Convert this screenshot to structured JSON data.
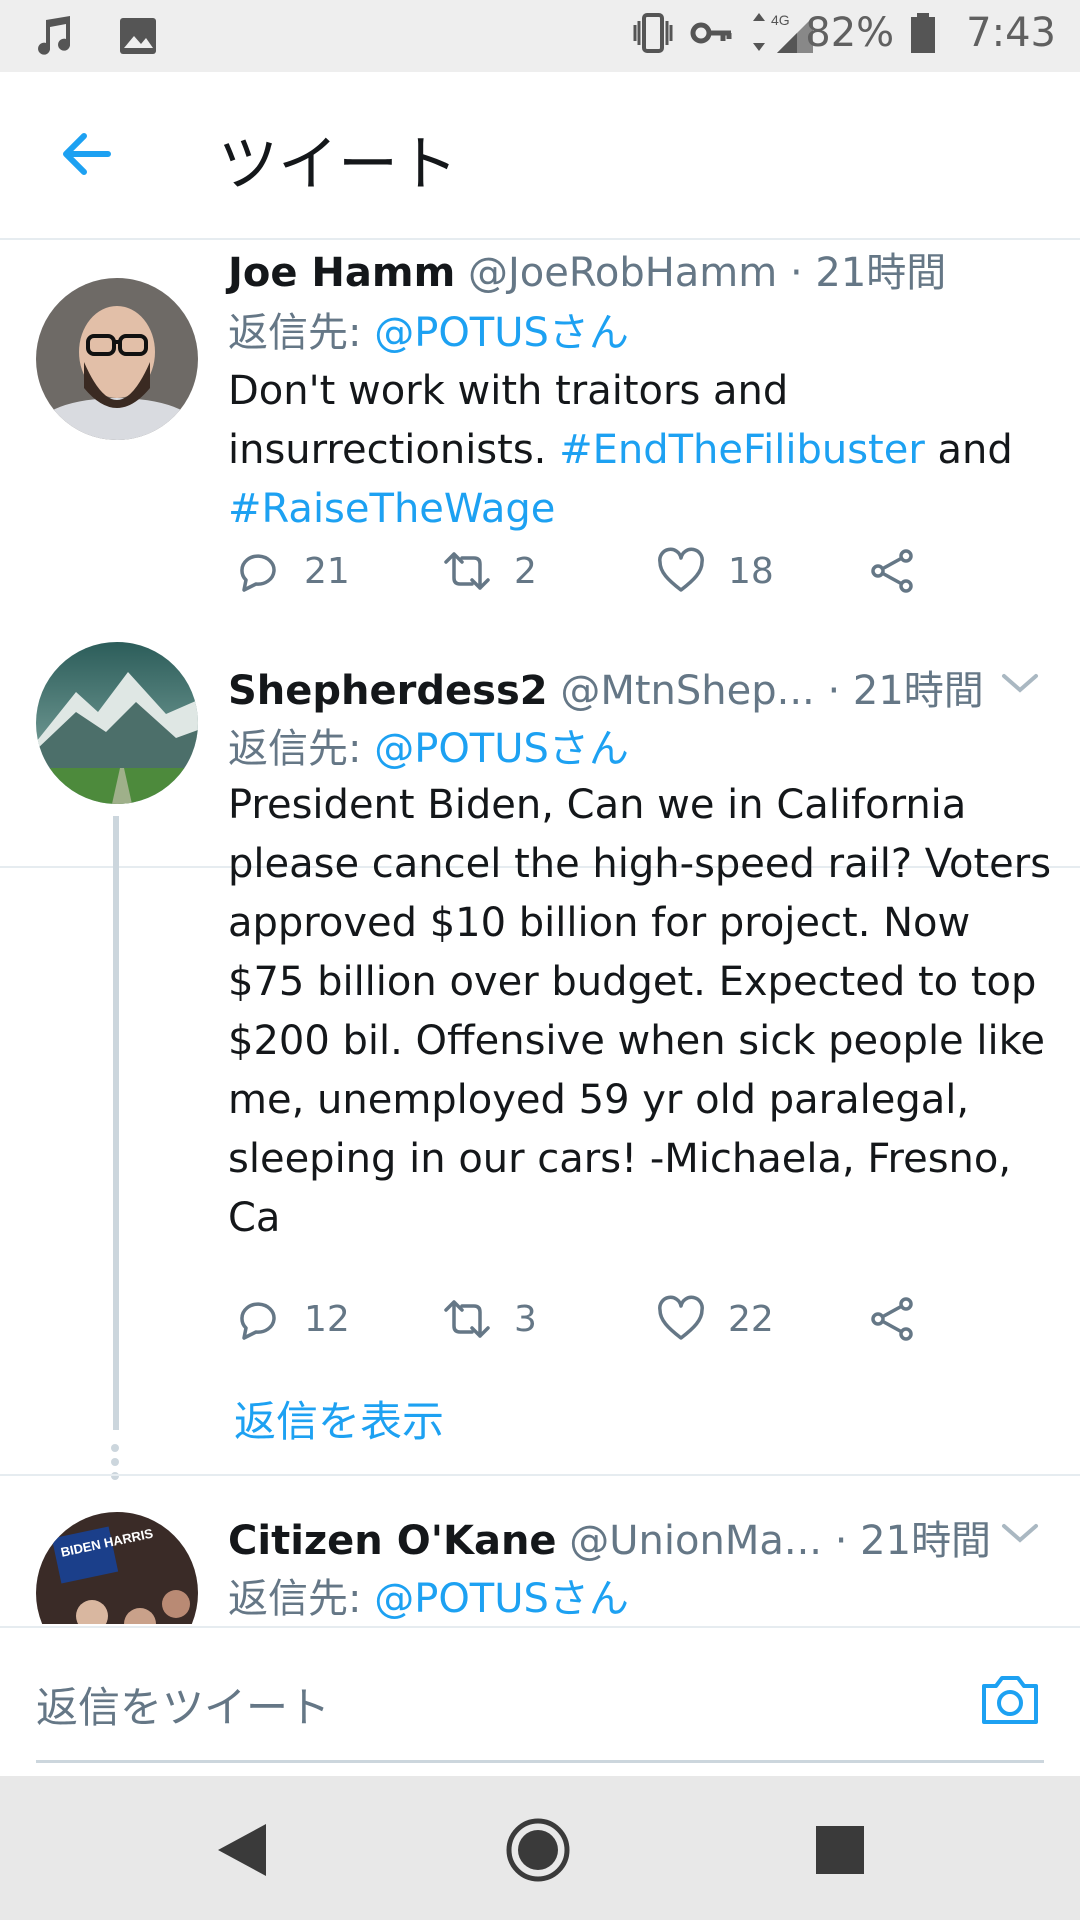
{
  "status_bar": {
    "battery": "82%",
    "network": "4G",
    "time": "7:43"
  },
  "header": {
    "title": "ツイート"
  },
  "tweets": [
    {
      "name": "Joe Hamm",
      "handle": "@JoeRobHamm",
      "time": "· 21時間",
      "reply_prefix": "返信先: ",
      "reply_to": "@POTUSさん",
      "text_1": "Don't work with traitors and insurrectionists. ",
      "hashtag_1": "#EndTheFilibuster",
      "text_2": " and ",
      "hashtag_2": "#RaiseTheWage",
      "replies": "21",
      "retweets": "2",
      "likes": "18"
    },
    {
      "name": "Shepherdess2",
      "handle": "@MtnShep...",
      "time": "· 21時間",
      "reply_prefix": "返信先: ",
      "reply_to": "@POTUSさん",
      "text": "President Biden, Can we in California please cancel the high-speed rail? Voters approved $10 billion for project. Now $75 billion over budget. Expected to top $200 bil. Offensive when sick people like me, unemployed 59 yr old paralegal, sleeping in our cars! -Michaela, Fresno, Ca",
      "replies": "12",
      "retweets": "3",
      "likes": "22",
      "show_replies": "返信を表示"
    },
    {
      "name": "Citizen O'Kane",
      "handle": "@UnionMa...",
      "time": "· 21時間",
      "reply_prefix": "返信先: ",
      "reply_to": "@POTUSさん",
      "avatar_sign": "BIDEN HARRIS"
    }
  ],
  "composer": {
    "placeholder": "返信をツイート"
  },
  "colors": {
    "accent": "#1da1f2",
    "secondary_text": "#657786",
    "divider": "#e6ecf0"
  }
}
